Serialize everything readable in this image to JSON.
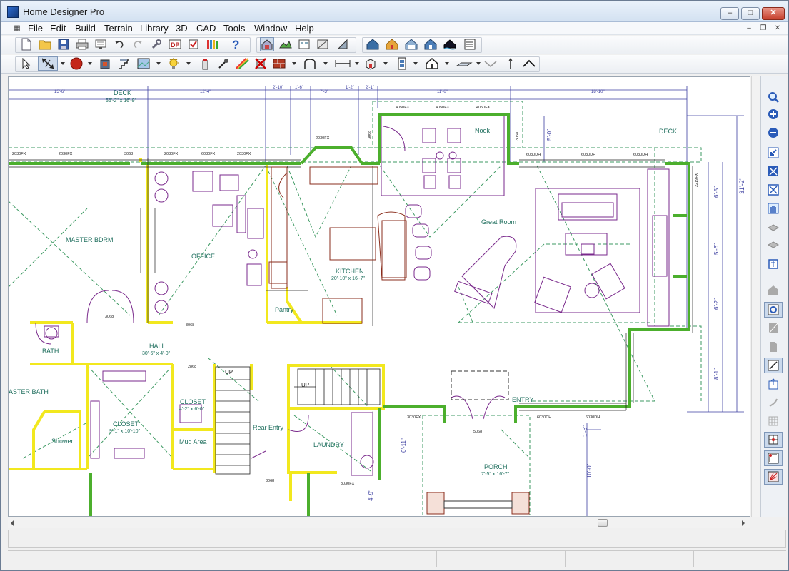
{
  "window": {
    "title": "Home Designer Pro"
  },
  "menu": {
    "items": [
      "File",
      "Edit",
      "Build",
      "Terrain",
      "Library",
      "3D",
      "CAD",
      "Tools",
      "Window",
      "Help"
    ]
  },
  "plan": {
    "colors": {
      "wall": "#f2e81e",
      "exterior_wall": "#4caf2d",
      "dimension": "#3c3fa0",
      "furniture": "#7a2a8c",
      "dashed": "#3e9a63",
      "text": "#1f6f5e"
    },
    "dims_top": [
      "15'-6\"",
      "12'-4\"",
      "2'-10\"",
      "1'-6\"",
      "7'-3\"",
      "1'-2\"",
      "2'-1\"",
      "11'-0\"",
      "18'-10\""
    ],
    "dims_right": [
      "31'-2\"",
      "6'-5\"",
      "5'-6\"",
      "6'-2\"",
      "8'-1\"",
      "5'-0\""
    ],
    "dims_bottom": [
      "6'-11\"",
      "4'-9\"",
      "1'-6\"",
      "10'-0\""
    ],
    "rooms": [
      {
        "name": "DECK",
        "sub": "56'-2\" x 16'-9\""
      },
      {
        "name": "DECK",
        "sub": ""
      },
      {
        "name": "MASTER BDRM",
        "sub": ""
      },
      {
        "name": "OFFICE",
        "sub": ""
      },
      {
        "name": "KITCHEN",
        "sub": "20'-10\" x 16'-7\""
      },
      {
        "name": "Nook",
        "sub": ""
      },
      {
        "name": "Great Room",
        "sub": ""
      },
      {
        "name": "Pantry",
        "sub": ""
      },
      {
        "name": "HALL",
        "sub": "30'-6\" x 4'-0\""
      },
      {
        "name": "BATH",
        "sub": ""
      },
      {
        "name": "ASTER BATH",
        "sub": ""
      },
      {
        "name": "Shower",
        "sub": ""
      },
      {
        "name": "CLOSET",
        "sub": "9'-1\" x 10'-10\""
      },
      {
        "name": "CLOSET",
        "sub": "4'-2\" x 6'-0\""
      },
      {
        "name": "Mud Area",
        "sub": ""
      },
      {
        "name": "Rear Entry",
        "sub": ""
      },
      {
        "name": "LAUNDRY",
        "sub": ""
      },
      {
        "name": "ENTRY",
        "sub": ""
      },
      {
        "name": "PORCH",
        "sub": "7'-5\" x 16'-7\""
      }
    ],
    "stairs": [
      "UP",
      "UP"
    ],
    "window_labels": [
      "2030FX",
      "2030FX",
      "3068",
      "2030FX",
      "6030FX",
      "2030FX",
      "4050FX",
      "4050FX",
      "4050FX",
      "2030FX",
      "6030DH",
      "6030DH",
      "6030DH",
      "2219FX",
      "3068",
      "2868",
      "3068",
      "3068",
      "3068",
      "3068",
      "3030FX",
      "3030FX",
      "6030DH",
      "6030DH",
      "5068"
    ]
  }
}
